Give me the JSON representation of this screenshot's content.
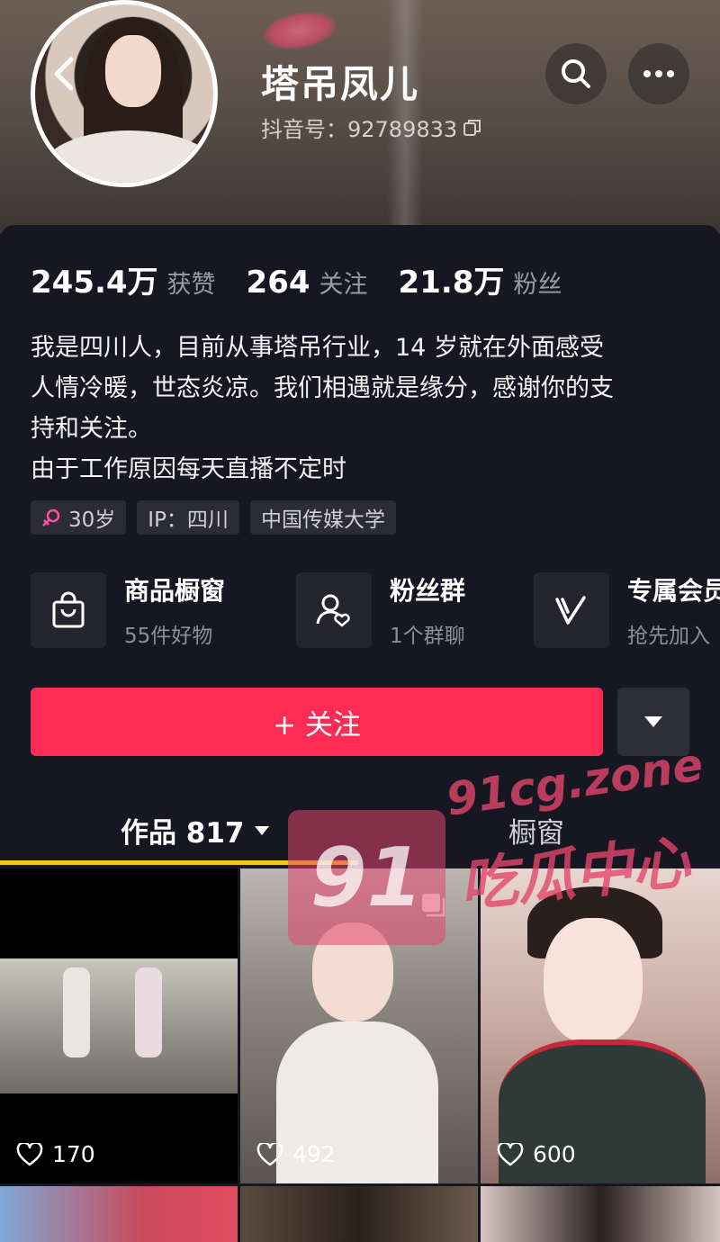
{
  "profile": {
    "name": "塔吊凤儿",
    "douyin_id": "抖音号：92789833"
  },
  "stats": [
    {
      "value": "245.4万",
      "label": "获赞"
    },
    {
      "value": "264",
      "label": "关注"
    },
    {
      "value": "21.8万",
      "label": "粉丝"
    }
  ],
  "bio": {
    "line1": "我是四川人，目前从事塔吊行业，14 岁就在外面感受",
    "line2": "人情冷暖，世态炎凉。我们相遇就是缘分，感谢你的支",
    "line3": "持和关注。",
    "line4": "由于工作原因每天直播不定时"
  },
  "tags": {
    "age": "30岁",
    "ip": "IP：四川",
    "school": "中国传媒大学"
  },
  "services": [
    {
      "title": "商品橱窗",
      "sub": "55件好物",
      "icon": "shopping-bag-icon"
    },
    {
      "title": "粉丝群",
      "sub": "1个群聊",
      "icon": "fan-group-icon"
    },
    {
      "title": "专属会员",
      "sub": "抢先加入",
      "icon": "v-member-icon"
    }
  ],
  "actions": {
    "follow": "+ 关注"
  },
  "tabs": {
    "works": "作品 817",
    "showcase": "橱窗"
  },
  "videos": [
    {
      "likes": "170"
    },
    {
      "likes": "492"
    },
    {
      "likes": "600"
    }
  ],
  "watermark": {
    "badge": "91",
    "domain": "91cg.zone",
    "sub": "吃瓜中心"
  },
  "colors": {
    "accent": "#fe2c55",
    "tab_underline": "#f5c518",
    "female_icon": "#ff4fa3"
  }
}
